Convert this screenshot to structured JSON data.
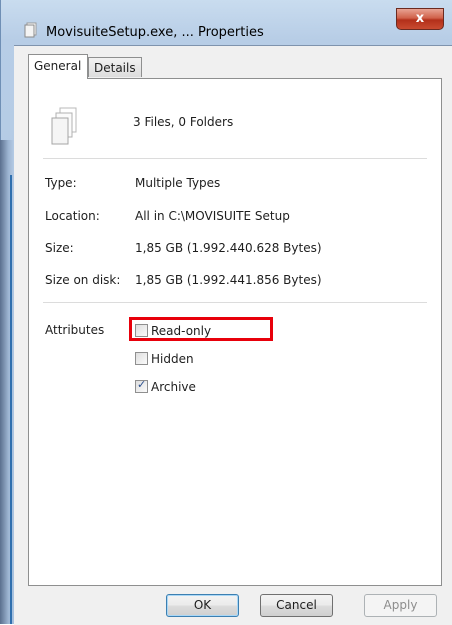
{
  "window": {
    "title": "MovisuiteSetup.exe, ... Properties",
    "close_glyph": "x"
  },
  "tabs": [
    {
      "label": "General",
      "active": true
    },
    {
      "label": "Details",
      "active": false
    }
  ],
  "summary": {
    "icon": "multiple-files-icon",
    "text": "3 Files, 0 Folders"
  },
  "properties": [
    {
      "label": "Type:",
      "value": "Multiple Types"
    },
    {
      "label": "Location:",
      "value": "All in C:\\MOVISUITE Setup"
    },
    {
      "label": "Size:",
      "value": "1,85 GB (1.992.440.628 Bytes)"
    },
    {
      "label": "Size on disk:",
      "value": "1,85 GB (1.992.441.856 Bytes)"
    }
  ],
  "attributes": {
    "label": "Attributes",
    "items": [
      {
        "label": "Read-only",
        "checked": false
      },
      {
        "label": "Hidden",
        "checked": false
      },
      {
        "label": "Archive",
        "checked": true
      }
    ]
  },
  "buttons": {
    "ok": "OK",
    "cancel": "Cancel",
    "apply": "Apply"
  },
  "colors": {
    "highlight": "#e8000b",
    "close_button": "#c94a30"
  }
}
